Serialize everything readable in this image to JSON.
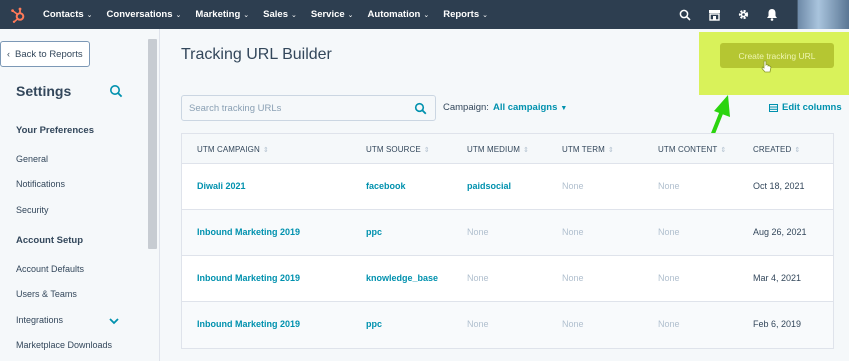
{
  "topnav": {
    "items": [
      "Contacts",
      "Conversations",
      "Marketing",
      "Sales",
      "Service",
      "Automation",
      "Reports"
    ]
  },
  "sidebar": {
    "back_label": "Back to Reports",
    "title": "Settings",
    "sections": [
      {
        "heading": "Your Preferences",
        "items": [
          "General",
          "Notifications",
          "Security"
        ]
      },
      {
        "heading": "Account Setup",
        "items": [
          "Account Defaults",
          "Users & Teams",
          "Integrations",
          "Marketplace Downloads"
        ]
      }
    ]
  },
  "main": {
    "title": "Tracking URL Builder",
    "create_button": "Create tracking URL",
    "search_placeholder": "Search tracking URLs",
    "campaign_label": "Campaign:",
    "campaign_value": "All campaigns",
    "edit_columns": "Edit columns",
    "columns": [
      "UTM CAMPAIGN",
      "UTM SOURCE",
      "UTM MEDIUM",
      "UTM TERM",
      "UTM CONTENT",
      "CREATED"
    ],
    "rows": [
      {
        "campaign": "Diwali 2021",
        "source": "facebook",
        "medium": "paidsocial",
        "term": "None",
        "content": "None",
        "created": "Oct 18, 2021"
      },
      {
        "campaign": "Inbound Marketing 2019",
        "source": "ppc",
        "medium": "None",
        "term": "None",
        "content": "None",
        "created": "Aug 26, 2021"
      },
      {
        "campaign": "Inbound Marketing 2019",
        "source": "knowledge_base",
        "medium": "None",
        "term": "None",
        "content": "None",
        "created": "Mar 4, 2021"
      },
      {
        "campaign": "Inbound Marketing 2019",
        "source": "ppc",
        "medium": "None",
        "term": "None",
        "content": "None",
        "created": "Feb 6, 2019"
      }
    ]
  },
  "colors": {
    "nav_bg": "#2d3e50",
    "link": "#0091ae",
    "highlight": "#d9f25a",
    "annotation_arrow": "#2bd40e"
  }
}
